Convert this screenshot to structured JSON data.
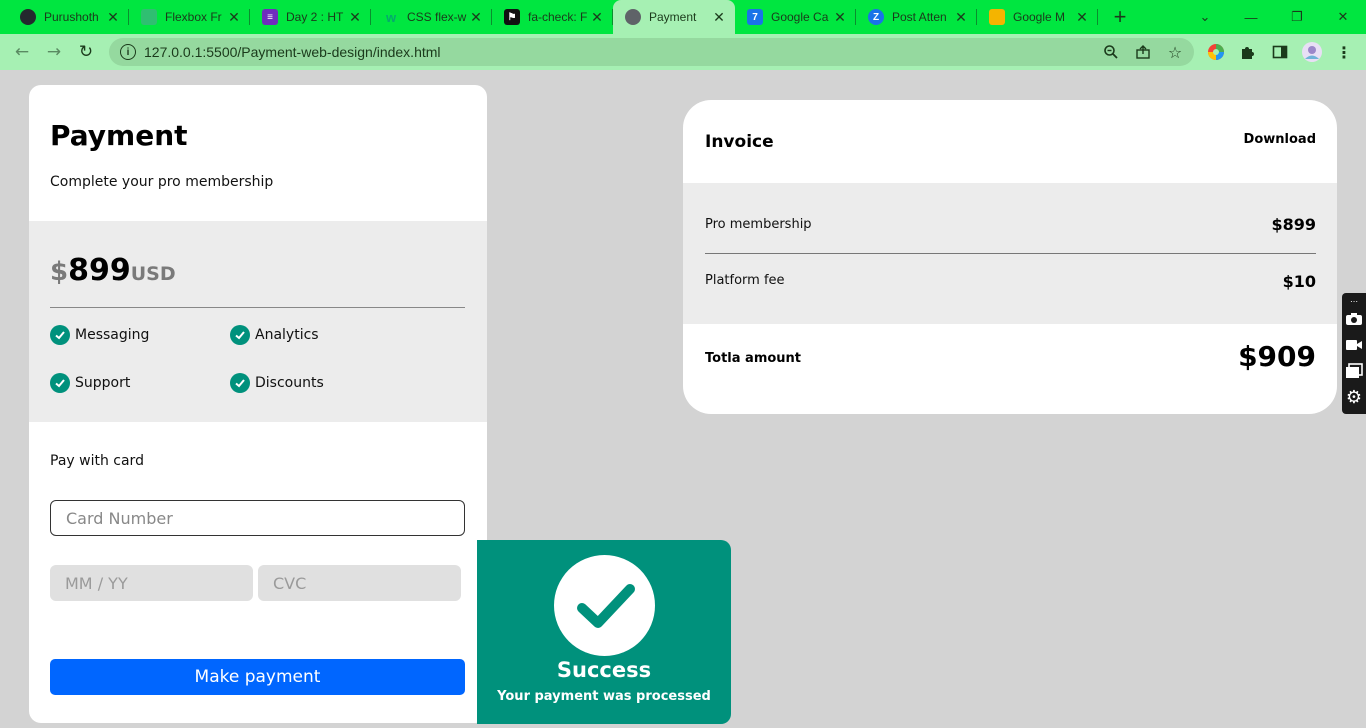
{
  "browser": {
    "tabs": [
      {
        "title": "Purushoth",
        "favicon": "github-icon",
        "color": "#24292e",
        "active": false
      },
      {
        "title": "Flexbox Fr",
        "favicon": "frog-icon",
        "color": "#2fbf71",
        "active": false
      },
      {
        "title": "Day 2 : HT",
        "favicon": "list-icon",
        "color": "#6f2dbd",
        "active": false
      },
      {
        "title": "CSS flex-w",
        "favicon": "w3-icon",
        "color": "#04aa6d",
        "active": false
      },
      {
        "title": "fa-check: F",
        "favicon": "flag-icon",
        "color": "#111111",
        "active": false
      },
      {
        "title": "Payment",
        "favicon": "globe-icon",
        "color": "#5f6368",
        "active": true
      },
      {
        "title": "Google Ca",
        "favicon": "calendar-icon",
        "color": "#1a73e8",
        "active": false
      },
      {
        "title": "Post Atten",
        "favicon": "zoho-icon",
        "color": "#1a73e8",
        "active": false
      },
      {
        "title": "Google M",
        "favicon": "drive-icon",
        "color": "#f4b400",
        "active": false
      }
    ],
    "url": "127.0.0.1:5500/Payment-web-design/index.html",
    "tab_close": "✕",
    "new_tab": "+"
  },
  "payment": {
    "title": "Payment",
    "subtitle": "Complete your pro membership",
    "currency_symbol": "$",
    "amount": "899",
    "unit": "USD",
    "features": [
      "Messaging",
      "Analytics",
      "Support",
      "Discounts"
    ],
    "pay_with_label": "Pay with card",
    "card_number_placeholder": "Card Number",
    "expiry_placeholder": "MM / YY",
    "cvc_placeholder": "CVC",
    "button_label": "Make payment"
  },
  "success": {
    "title": "Success",
    "message": "Your payment was processed"
  },
  "invoice": {
    "title": "Invoice",
    "download_label": "Download",
    "items": [
      {
        "label": "Pro membership",
        "value": "$899"
      },
      {
        "label": "Platform fee",
        "value": "$10"
      }
    ],
    "total_label": "Totla amount",
    "total_value": "$909"
  },
  "colors": {
    "accent_green": "#00917c",
    "button_blue": "#0066ff",
    "page_bg": "#d3d3d3",
    "chrome_green": "#00e640"
  }
}
